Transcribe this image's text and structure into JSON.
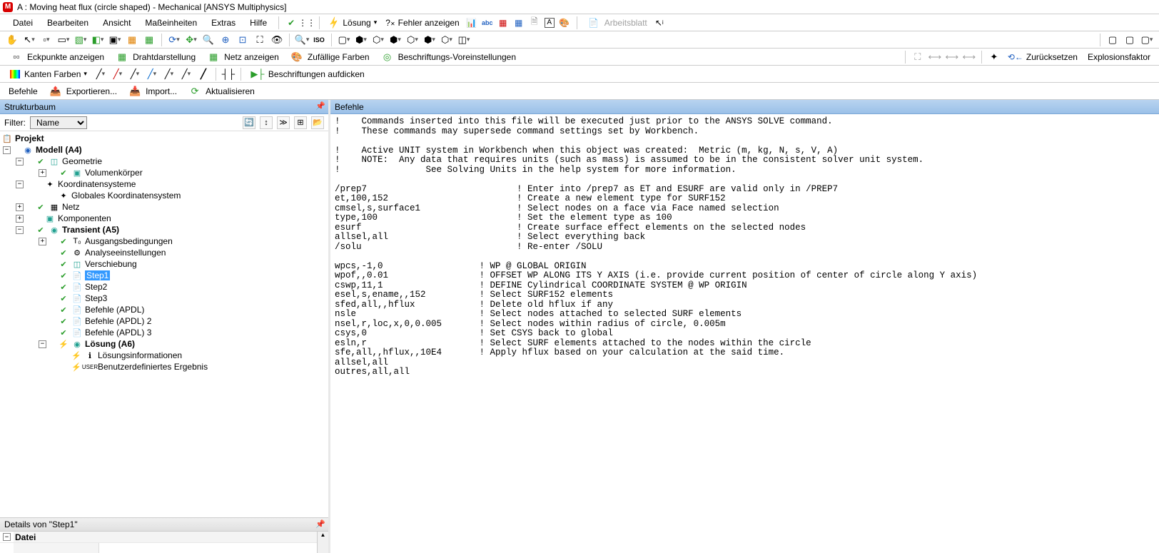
{
  "window": {
    "title": "A : Moving heat flux (circle shaped) - Mechanical [ANSYS Multiphysics]"
  },
  "menubar": {
    "items": [
      "Datei",
      "Bearbeiten",
      "Ansicht",
      "Maßeinheiten",
      "Extras",
      "Hilfe"
    ],
    "losung": "Lösung",
    "fehler": "Fehler anzeigen",
    "arbeitsblatt": "Arbeitsblatt"
  },
  "toolbar2": {
    "eckpunkte": "Eckpunkte anzeigen",
    "draht": "Drahtdarstellung",
    "netz": "Netz anzeigen",
    "zufallige": "Zufällige Farben",
    "beschriftungs": "Beschriftungs-Voreinstellungen",
    "zuruck": "Zurücksetzen",
    "explosions": "Explosionsfaktor"
  },
  "toolbar3": {
    "kanten": "Kanten Farben",
    "beschriftungen": "Beschriftungen aufdicken"
  },
  "toolbar4": {
    "befehle": "Befehle",
    "exportieren": "Exportieren...",
    "import": "Import...",
    "aktualisieren": "Aktualisieren"
  },
  "panes": {
    "strukturbaum": "Strukturbaum",
    "befehle": "Befehle",
    "details_title": "Details von \"Step1\"",
    "datei": "Datei"
  },
  "filter": {
    "label": "Filter:",
    "option": "Name"
  },
  "tree": {
    "projekt": "Projekt",
    "modell": "Modell (A4)",
    "geometrie": "Geometrie",
    "volumen": "Volumenkörper",
    "koord": "Koordinatensysteme",
    "glob_koord": "Globales Koordinatensystem",
    "netz": "Netz",
    "komponenten": "Komponenten",
    "transient": "Transient (A5)",
    "ausgangs": "Ausgangsbedingungen",
    "analyse": "Analyseeinstellungen",
    "verschiebung": "Verschiebung",
    "step1": "Step1",
    "step2": "Step2",
    "step3": "Step3",
    "befehle_apdl": "Befehle (APDL)",
    "befehle_apdl2": "Befehle (APDL) 2",
    "befehle_apdl3": "Befehle (APDL) 3",
    "losung": "Lösung (A6)",
    "losungsinfo": "Lösungsinformationen",
    "benutzer": "Benutzerdefiniertes Ergebnis"
  },
  "code": "!    Commands inserted into this file will be executed just prior to the ANSYS SOLVE command.\n!    These commands may supersede command settings set by Workbench.\n\n!    Active UNIT system in Workbench when this object was created:  Metric (m, kg, N, s, V, A)\n!    NOTE:  Any data that requires units (such as mass) is assumed to be in the consistent solver unit system.\n!                See Solving Units in the help system for more information.\n\n/prep7                            ! Enter into /prep7 as ET and ESURF are valid only in /PREP7\net,100,152                        ! Create a new element type for SURF152\ncmsel,s,surface1                  ! Select nodes on a face via Face named selection\ntype,100                          ! Set the element type as 100\nesurf                             ! Create surface effect elements on the selected nodes\nallsel,all                        ! Select everything back\n/solu                             ! Re-enter /SOLU\n\nwpcs,-1,0                  ! WP @ GLOBAL ORIGIN\nwpof,,0.01                 ! OFFSET WP ALONG ITS Y AXIS (i.e. provide current position of center of circle along Y axis)\ncswp,11,1                  ! DEFINE Cylindrical COORDINATE SYSTEM @ WP ORIGIN\nesel,s,ename,,152          ! Select SURF152 elements\nsfed,all,,hflux            ! Delete old hflux if any\nnsle                       ! Select nodes attached to selected SURF elements\nnsel,r,loc,x,0,0.005       ! Select nodes within radius of circle, 0.005m\ncsys,0                     ! Set CSYS back to global\nesln,r                     ! Select SURF elements attached to the nodes within the circle\nsfe,all,,hflux,,10E4       ! Apply hflux based on your calculation at the said time.\nallsel,all\noutres,all,all"
}
